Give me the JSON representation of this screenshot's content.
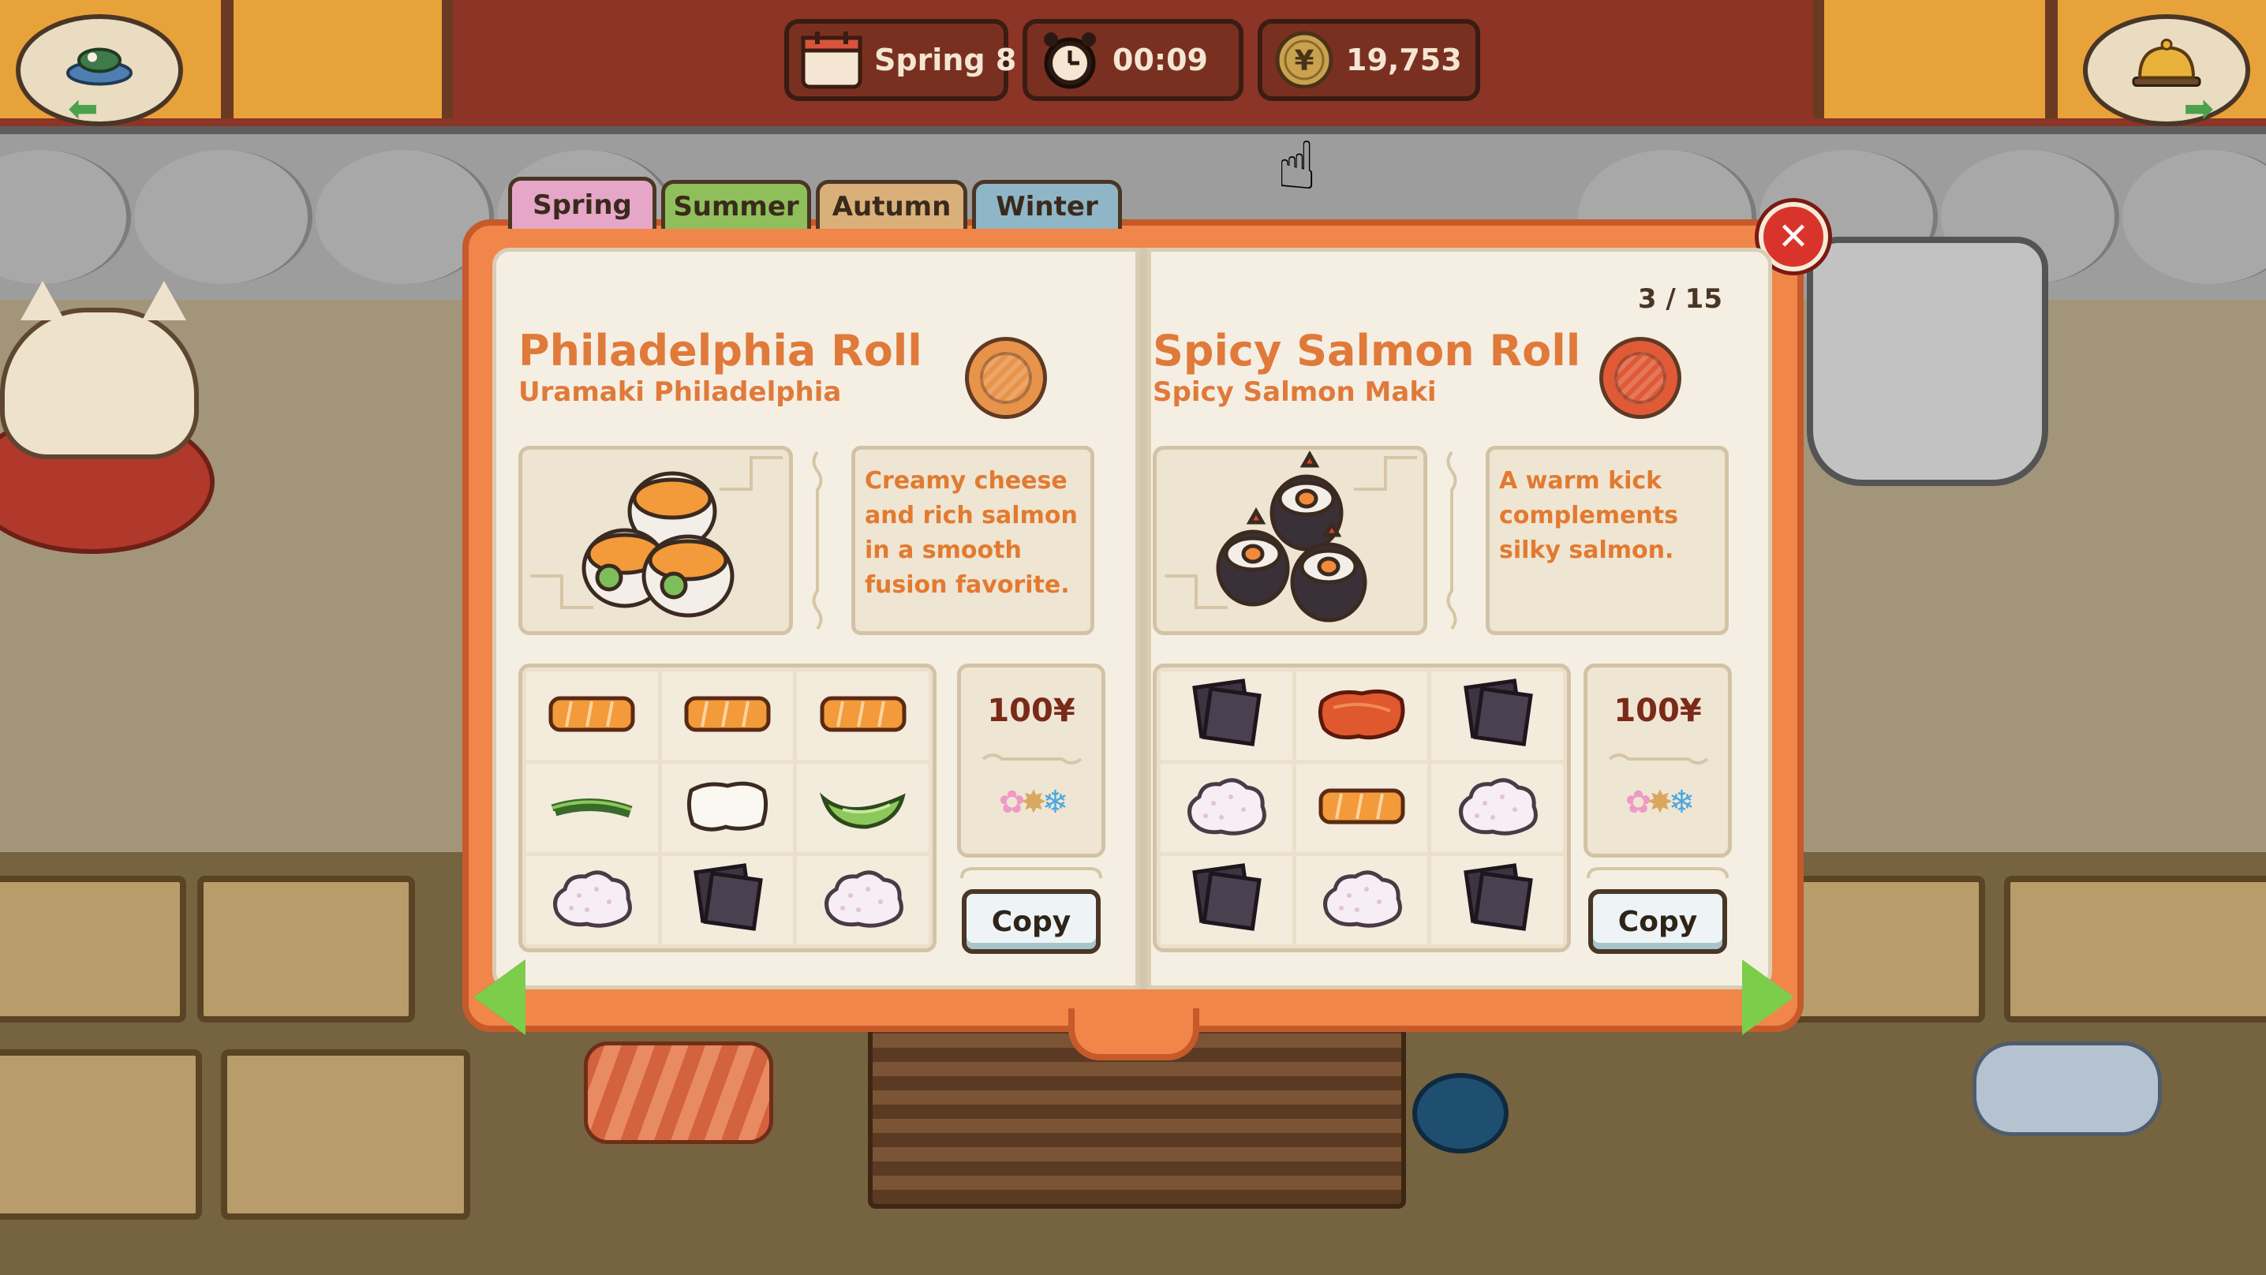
{
  "hud": {
    "date_label": "Spring 8",
    "timer_label": "00:09",
    "money_label": "19,753",
    "left_button_icon": "sushi-plate-icon",
    "right_button_icon": "service-bell-icon"
  },
  "book": {
    "tabs": [
      {
        "label": "Spring",
        "color": "#e6a6c8",
        "active": true
      },
      {
        "label": "Summer",
        "color": "#8fbf5a",
        "active": false
      },
      {
        "label": "Autumn",
        "color": "#d9b07a",
        "active": false
      },
      {
        "label": "Winter",
        "color": "#8fb6c6",
        "active": false
      }
    ],
    "page_indicator": "3 / 15",
    "close_icon": "close-icon",
    "prev_icon": "arrow-left-icon",
    "next_icon": "arrow-right-icon"
  },
  "recipes": [
    {
      "title": "Philadelphia Roll",
      "subtitle": "Uramaki Philadelphia",
      "coin": "bronze-coin",
      "description": "Creamy cheese and rich salmon in a smooth fusion favorite.",
      "ingredients": [
        "salmon",
        "salmon",
        "salmon",
        "green-onion",
        "cream-cheese",
        "cucumber",
        "rice",
        "nori",
        "rice"
      ],
      "price": "100¥",
      "seasons": [
        "spring",
        "autumn",
        "winter"
      ],
      "copy_label": "Copy"
    },
    {
      "title": "Spicy Salmon Roll",
      "subtitle": "Spicy Salmon Maki",
      "coin": "red-coin",
      "description": "A warm kick complements silky salmon.",
      "ingredients": [
        "nori",
        "spicy-salmon",
        "nori",
        "rice",
        "salmon",
        "rice",
        "nori",
        "rice",
        "nori"
      ],
      "price": "100¥",
      "seasons": [
        "spring",
        "autumn",
        "winter"
      ],
      "copy_label": "Copy"
    }
  ],
  "colors": {
    "accent_orange": "#e07a3a",
    "book_border": "#f0864a",
    "price_text": "#7a2a18",
    "nav_green": "#7ccd4a"
  }
}
